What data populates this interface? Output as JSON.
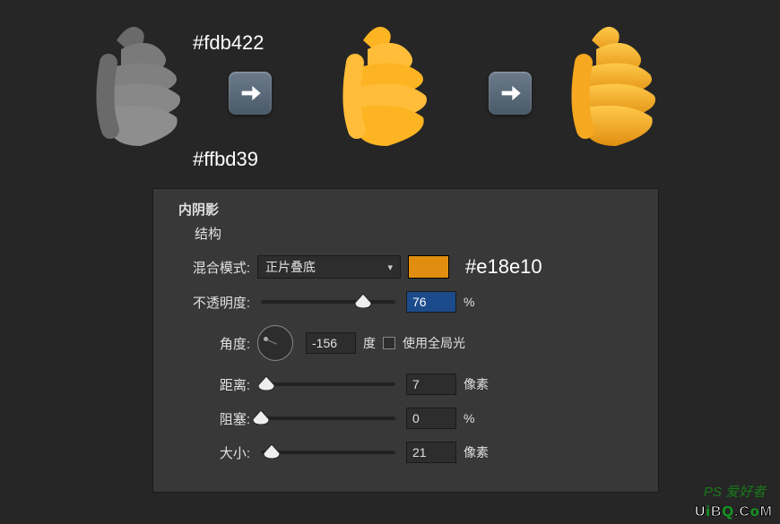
{
  "top": {
    "color1_hex": "#fdb422",
    "color2_hex": "#ffbd39"
  },
  "panel": {
    "title": "内阴影",
    "subtitle": "结构",
    "blend_mode": {
      "label": "混合模式:",
      "value": "正片叠底"
    },
    "swatch_hex": "#e18e10",
    "opacity": {
      "label": "不透明度:",
      "value": "76",
      "unit": "%"
    },
    "angle": {
      "label": "角度:",
      "value": "-156",
      "unit": "度",
      "global_label": "使用全局光"
    },
    "distance": {
      "label": "距离:",
      "value": "7",
      "unit": "像素"
    },
    "choke": {
      "label": "阻塞:",
      "value": "0",
      "unit": "%"
    },
    "size": {
      "label": "大小:",
      "value": "21",
      "unit": "像素"
    }
  },
  "watermark": {
    "site": "UiBQ.CoM",
    "brand": "PS"
  }
}
